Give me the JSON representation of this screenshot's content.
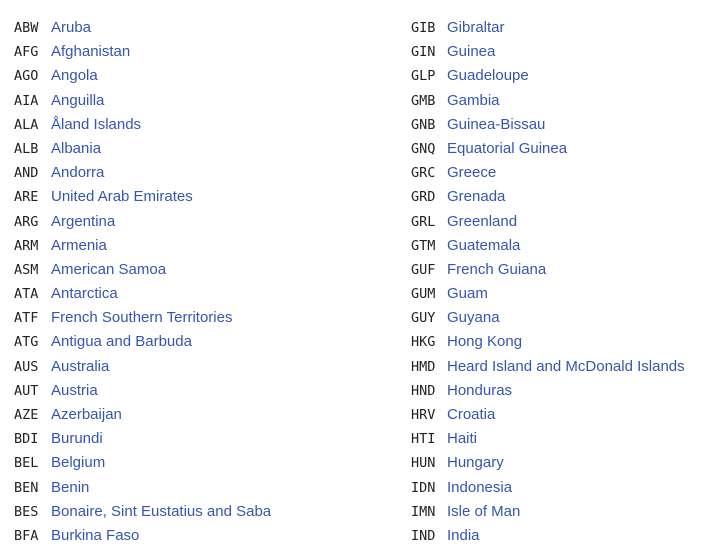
{
  "link_color": "#3655b3",
  "left": [
    {
      "code": "ABW",
      "name": "Aruba"
    },
    {
      "code": "AFG",
      "name": "Afghanistan"
    },
    {
      "code": "AGO",
      "name": "Angola"
    },
    {
      "code": "AIA",
      "name": "Anguilla"
    },
    {
      "code": "ALA",
      "name": "Åland Islands"
    },
    {
      "code": "ALB",
      "name": "Albania"
    },
    {
      "code": "AND",
      "name": "Andorra"
    },
    {
      "code": "ARE",
      "name": "United Arab Emirates"
    },
    {
      "code": "ARG",
      "name": "Argentina"
    },
    {
      "code": "ARM",
      "name": "Armenia"
    },
    {
      "code": "ASM",
      "name": "American Samoa"
    },
    {
      "code": "ATA",
      "name": "Antarctica"
    },
    {
      "code": "ATF",
      "name": "French Southern Territories"
    },
    {
      "code": "ATG",
      "name": "Antigua and Barbuda"
    },
    {
      "code": "AUS",
      "name": "Australia"
    },
    {
      "code": "AUT",
      "name": "Austria"
    },
    {
      "code": "AZE",
      "name": "Azerbaijan"
    },
    {
      "code": "BDI",
      "name": "Burundi"
    },
    {
      "code": "BEL",
      "name": "Belgium"
    },
    {
      "code": "BEN",
      "name": "Benin"
    },
    {
      "code": "BES",
      "name": "Bonaire, Sint Eustatius and Saba"
    },
    {
      "code": "BFA",
      "name": "Burkina Faso"
    }
  ],
  "right": [
    {
      "code": "GIB",
      "name": "Gibraltar"
    },
    {
      "code": "GIN",
      "name": "Guinea"
    },
    {
      "code": "GLP",
      "name": "Guadeloupe"
    },
    {
      "code": "GMB",
      "name": "Gambia"
    },
    {
      "code": "GNB",
      "name": "Guinea-Bissau"
    },
    {
      "code": "GNQ",
      "name": "Equatorial Guinea"
    },
    {
      "code": "GRC",
      "name": "Greece"
    },
    {
      "code": "GRD",
      "name": "Grenada"
    },
    {
      "code": "GRL",
      "name": "Greenland"
    },
    {
      "code": "GTM",
      "name": "Guatemala"
    },
    {
      "code": "GUF",
      "name": "French Guiana"
    },
    {
      "code": "GUM",
      "name": "Guam"
    },
    {
      "code": "GUY",
      "name": "Guyana"
    },
    {
      "code": "HKG",
      "name": "Hong Kong"
    },
    {
      "code": "HMD",
      "name": "Heard Island and McDonald Islands"
    },
    {
      "code": "HND",
      "name": "Honduras"
    },
    {
      "code": "HRV",
      "name": "Croatia"
    },
    {
      "code": "HTI",
      "name": "Haiti"
    },
    {
      "code": "HUN",
      "name": "Hungary"
    },
    {
      "code": "IDN",
      "name": "Indonesia"
    },
    {
      "code": "IMN",
      "name": "Isle of Man"
    },
    {
      "code": "IND",
      "name": "India"
    }
  ]
}
